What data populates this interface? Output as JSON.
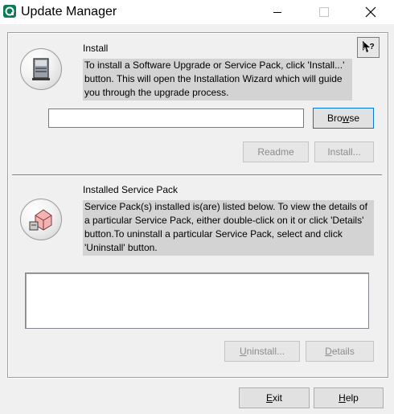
{
  "window": {
    "title": "Update Manager",
    "icon": "app-logo-icon"
  },
  "install": {
    "heading": "Install",
    "description": "To install a Software Upgrade or Service Pack, click 'Install...' button. This will open the Installation Wizard which will guide you through the upgrade process.",
    "path_value": "",
    "browse_pre": "Bro",
    "browse_mnemonic": "w",
    "browse_post": "se",
    "readme_label": "Readme",
    "install_label": "Install..."
  },
  "service_pack": {
    "heading": "Installed Service Pack",
    "description": "Service Pack(s) installed is(are) listed below. To view the details of a particular Service Pack, either double-click on it or click 'Details' button.To uninstall a particular Service Pack, select and click 'Uninstall' button.",
    "items": [],
    "uninstall_mnemonic": "U",
    "uninstall_post": "ninstall...",
    "details_mnemonic": "D",
    "details_post": "etails"
  },
  "footer": {
    "exit_mnemonic": "E",
    "exit_post": "xit",
    "help_mnemonic": "H",
    "help_post": "elp"
  }
}
